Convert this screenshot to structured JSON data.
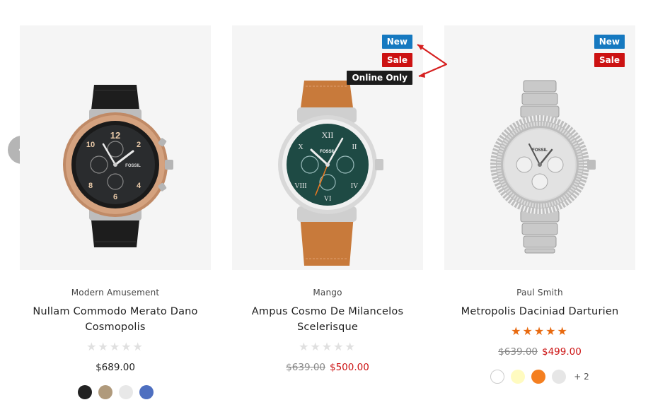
{
  "products": [
    {
      "brand": "Modern Amusement",
      "title": "Nullam Commodo Merato Dano Cosmopolis",
      "price": "$689.00",
      "rating": 0,
      "badges": [],
      "swatches": [
        "#222222",
        "#b09a7c",
        "#e8e8e8",
        "#4e6fc0"
      ],
      "watch_icon": "chronograph-watch-black-strap-icon"
    },
    {
      "brand": "Mango",
      "title": "Ampus Cosmo De Milancelos Scelerisque",
      "old_price": "$639.00",
      "new_price": "$500.00",
      "rating": 0,
      "badges": [
        "New",
        "Sale",
        "Online Only"
      ],
      "watch_icon": "chronograph-watch-tan-strap-icon"
    },
    {
      "brand": "Paul Smith",
      "title": "Metropolis Daciniad Darturien",
      "old_price": "$639.00",
      "new_price": "$499.00",
      "rating": 5,
      "badges": [
        "New",
        "Sale"
      ],
      "swatches": [
        "#ffffff",
        "#fffbc0",
        "#f47f20",
        "#e6e6e6"
      ],
      "more_swatches": "+ 2",
      "watch_icon": "crystal-bracelet-watch-silver-icon"
    }
  ],
  "carousel": {
    "prev_icon": "chevron-left-icon"
  },
  "colors": {
    "new_badge": "#1679c0",
    "sale_badge": "#cc1212",
    "online_badge": "#1c1c1c",
    "star_full": "#e86a10",
    "sale_price": "#cc1212"
  }
}
